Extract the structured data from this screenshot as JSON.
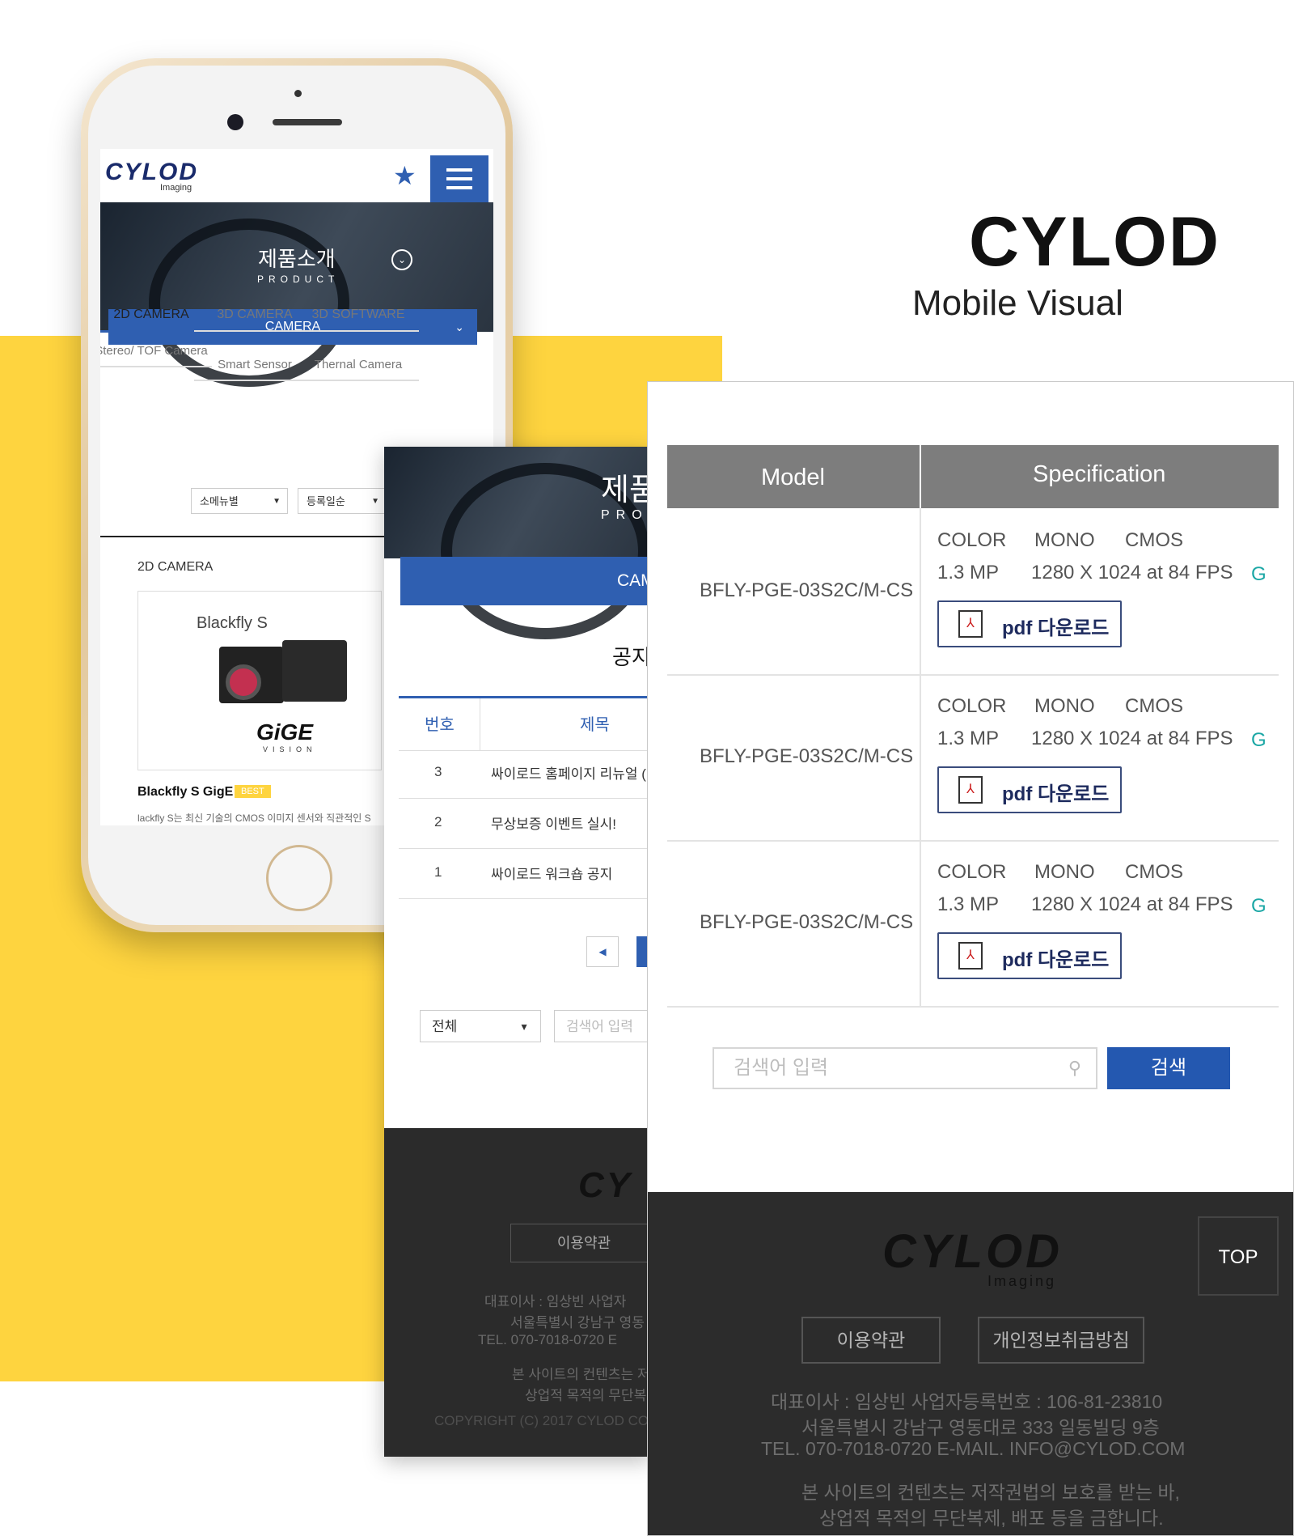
{
  "brand": {
    "title": "CYLOD",
    "subtitle": "Mobile Visual"
  },
  "phone": {
    "logo": "CYLOD",
    "logo_sub": "Imaging",
    "hero_title": "제품소개",
    "hero_sub": "PRODUCT",
    "camera_bar": "CAMERA",
    "tabs": [
      "2D CAMERA",
      "3D CAMERA",
      "3D SOFTWARE"
    ],
    "tabs2": [
      "Stereo/ TOF Camera",
      "Smart Sensor",
      "Thernal Camera"
    ],
    "sort1": "소메뉴별",
    "sort2": "등록일순",
    "section": "2D CAMERA",
    "product_brand": "Blackfly S",
    "gige": "GiGE",
    "gige_sub": "VISION",
    "product_title": "Blackfly S GigE",
    "badge": "BEST",
    "desc": "lackfly S는 최신 기술의 CMOS 이미지 센서와 직관적인 S"
  },
  "notice": {
    "hero_title": "제품",
    "hero_sub": "PRO",
    "bar": "CAM",
    "title": "공지",
    "headers": [
      "번호",
      "제목"
    ],
    "rows": [
      {
        "no": "3",
        "title": "싸이로드 홈페이지 리뉴얼 ("
      },
      {
        "no": "2",
        "title": "무상보증 이벤트 실시!"
      },
      {
        "no": "1",
        "title": "싸이로드 워크숍 공지"
      }
    ],
    "select": "전체",
    "search_placeholder": "검색어 입력",
    "footer_logo": "CY",
    "footer_btn": "이용약관",
    "footer_lines": [
      "대표이사 : 임상빈      사업자",
      "서울특별시 강남구 영동",
      "TEL. 070-7018-0720     E",
      "본 사이트의 컨텐츠는 저",
      "상업적 목적의 무단복",
      "COPYRIGHT (C) 2017 CYLOD COR"
    ]
  },
  "spec": {
    "headers": [
      "Model",
      "Specification"
    ],
    "rows": [
      {
        "model": "BFLY-PGE-03S2C/M-CS",
        "color": "COLOR",
        "mono": "MONO",
        "sensor": "CMOS",
        "mp": "1.3 MP",
        "res": "1280 X 1024 at 84 FPS",
        "g": "G",
        "pdf": "pdf 다운로드"
      },
      {
        "model": "BFLY-PGE-03S2C/M-CS",
        "color": "COLOR",
        "mono": "MONO",
        "sensor": "CMOS",
        "mp": "1.3 MP",
        "res": "1280 X 1024 at 84 FPS",
        "g": "G",
        "pdf": "pdf 다운로드"
      },
      {
        "model": "BFLY-PGE-03S2C/M-CS",
        "color": "COLOR",
        "mono": "MONO",
        "sensor": "CMOS",
        "mp": "1.3 MP",
        "res": "1280 X 1024 at 84 FPS",
        "g": "G",
        "pdf": "pdf 다운로드"
      }
    ],
    "search_placeholder": "검색어 입력",
    "search_button": "검색",
    "footer": {
      "top": "TOP",
      "logo": "CYLOD",
      "logo_sub": "Imaging",
      "btn_terms": "이용약관",
      "btn_privacy": "개인정보취급방침",
      "line1": "대표이사 : 임상빈      사업자등록번호 : 106-81-23810",
      "line2": "서울특별시 강남구 영동대로 333 일동빌딩 9층",
      "line3": "TEL. 070-7018-0720      E-MAIL. INFO@CYLOD.COM",
      "line4": "본 사이트의 컨텐츠는 저작권법의 보호를 받는 바,",
      "line5": "상업적 목적의 무단복제, 배포 등을 금합니다."
    }
  },
  "colors": {
    "accent": "#2f5fb1",
    "yellow": "#fed43f",
    "footer": "#2c2c2c",
    "teal": "#1ba7a5"
  }
}
